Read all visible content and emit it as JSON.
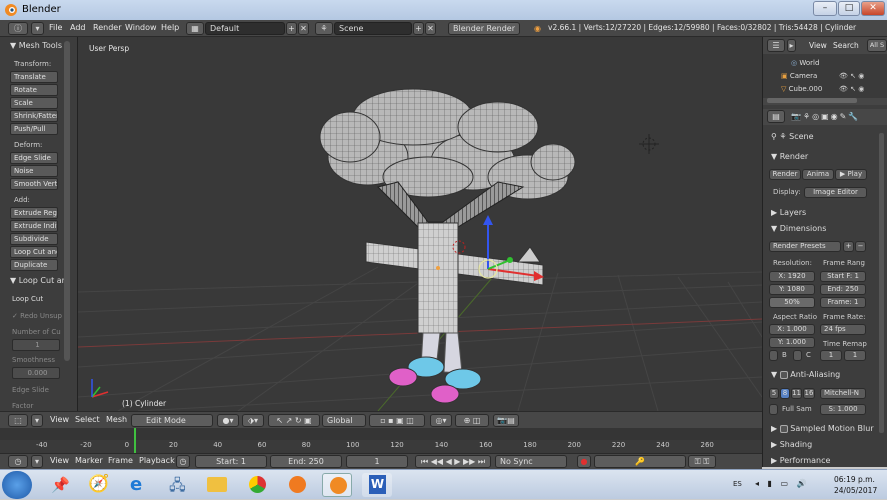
{
  "window": {
    "title": "Blender"
  },
  "topbar": {
    "menus": [
      "File",
      "Add",
      "Render",
      "Window",
      "Help"
    ],
    "layout": "Default",
    "scene": "Scene",
    "engine": "Blender Render",
    "stats": "v2.66.1 | Verts:12/27220 | Edges:12/59980 | Faces:0/32802 | Tris:54428 | Cylinder"
  },
  "tools": {
    "header": "Mesh Tools",
    "transform_label": "Transform:",
    "transform": [
      "Translate",
      "Rotate",
      "Scale",
      "Shrink/Fatten",
      "Push/Pull"
    ],
    "deform_label": "Deform:",
    "deform": [
      "Edge Slide",
      "Noise",
      "Smooth Vert"
    ],
    "add_label": "Add:",
    "add": [
      "Extrude Regi",
      "Extrude Indiv",
      "Subdivide",
      "Loop Cut and",
      "Duplicate"
    ],
    "op_header": "Loop Cut an",
    "op_name": "Loop Cut",
    "redo": "Redo Unsup",
    "cuts_label": "Number of Cu",
    "cuts_value": "1",
    "smooth_label": "Smoothness",
    "smooth_value": "0.000",
    "edge_slide": "Edge Slide",
    "factor": "Factor"
  },
  "viewport": {
    "view_name": "User Persp",
    "object_name": "(1) Cylinder"
  },
  "outliner": {
    "view": "View",
    "search": "Search",
    "all": "All S",
    "items": [
      "World",
      "Camera",
      "Cube.000"
    ]
  },
  "properties": {
    "scene": "Scene",
    "render_header": "Render",
    "render_btns": [
      "Render",
      "Anima",
      "Play"
    ],
    "display_label": "Display:",
    "display_value": "Image Editor",
    "layers": "Layers",
    "dimensions": "Dimensions",
    "presets": "Render Presets",
    "resolution_label": "Resolution:",
    "frame_range_label": "Frame Rang",
    "res_x": "X: 1920",
    "res_y": "Y: 1080",
    "res_pct": "50%",
    "start": "Start F: 1",
    "end": "End: 250",
    "frame": "Frame: 1",
    "aspect_label": "Aspect Ratio",
    "fps_label": "Frame Rate:",
    "asp_x": "X: 1.000",
    "asp_y": "Y: 1.000",
    "fps": "24 fps",
    "time_remap": "Time Remap",
    "b": "B",
    "c": "C",
    "remap_old": "1",
    "remap_new": "1",
    "aa_header": "Anti-Aliasing",
    "aa_samples": [
      "5",
      "8",
      "11",
      "16"
    ],
    "aa_filter": "Mitchell-N",
    "full_sample": "Full Sam",
    "filter_size": "S: 1.000",
    "motion_blur": "Sampled Motion Blur",
    "shading": "Shading",
    "performance": "Performance"
  },
  "vheader": {
    "menus": [
      "View",
      "Select",
      "Mesh"
    ],
    "mode": "Edit Mode",
    "orientation": "Global"
  },
  "timeline": {
    "ticks": [
      "-40",
      "-20",
      "0",
      "20",
      "40",
      "60",
      "80",
      "100",
      "120",
      "140",
      "160",
      "180",
      "200",
      "220",
      "240",
      "260"
    ]
  },
  "tlbar": {
    "menus": [
      "View",
      "Marker",
      "Frame",
      "Playback"
    ],
    "start": "Start: 1",
    "end": "End: 250",
    "current": "1",
    "sync": "No Sync"
  },
  "taskbar": {
    "lang": "ES",
    "time": "06:19 p.m.",
    "date": "24/05/2017"
  }
}
